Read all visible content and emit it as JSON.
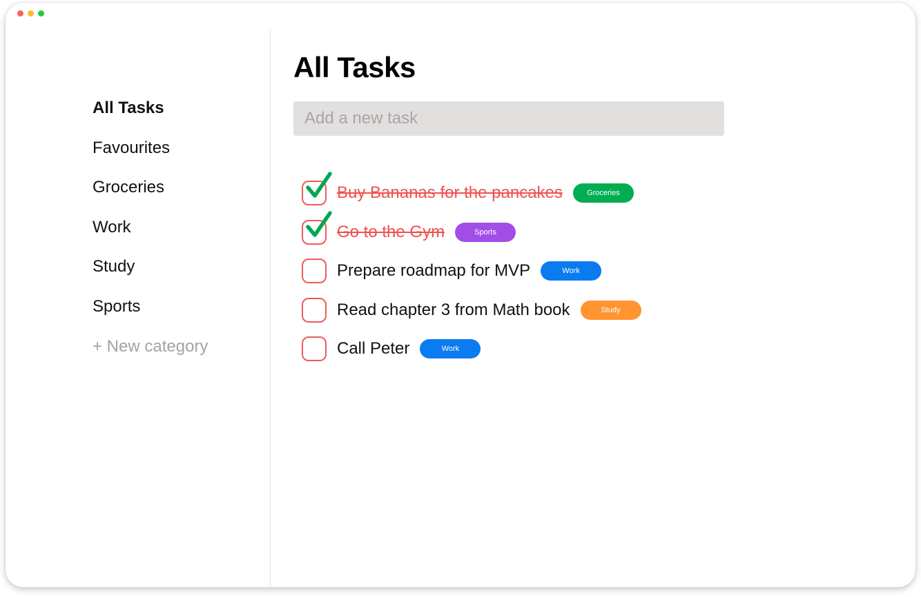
{
  "window": {
    "traffic_lights": [
      {
        "name": "close",
        "color": "#ff5f57"
      },
      {
        "name": "minimize",
        "color": "#febc2e"
      },
      {
        "name": "zoom",
        "color": "#28c840"
      }
    ]
  },
  "sidebar": {
    "items": [
      {
        "label": "All Tasks",
        "active": true
      },
      {
        "label": "Favourites"
      },
      {
        "label": "Groceries"
      },
      {
        "label": "Work"
      },
      {
        "label": "Study"
      },
      {
        "label": "Sports"
      }
    ],
    "new_category_label": "+ New category"
  },
  "main": {
    "title": "All Tasks",
    "new_task_placeholder": "Add a new task",
    "tasks": [
      {
        "text": "Buy Bananas for the pancakes",
        "done": true,
        "tag": "Groceries",
        "tag_color": "#00ad50"
      },
      {
        "text": "Go to the Gym",
        "done": true,
        "tag": "Sports",
        "tag_color": "#a24ee6"
      },
      {
        "text": "Prepare roadmap for MVP",
        "done": false,
        "tag": "Work",
        "tag_color": "#0a7bf0"
      },
      {
        "text": "Read chapter 3 from Math book",
        "done": false,
        "tag": "Study",
        "tag_color": "#ff9430"
      },
      {
        "text": "Call Peter",
        "done": false,
        "tag": "Work",
        "tag_color": "#0a7bf0"
      }
    ]
  },
  "colors": {
    "checkbox_border": "#ef5a5a",
    "checkmark": "#00a651",
    "done_text": "#ef5050"
  },
  "icons": {
    "checkmark": "check-icon"
  }
}
